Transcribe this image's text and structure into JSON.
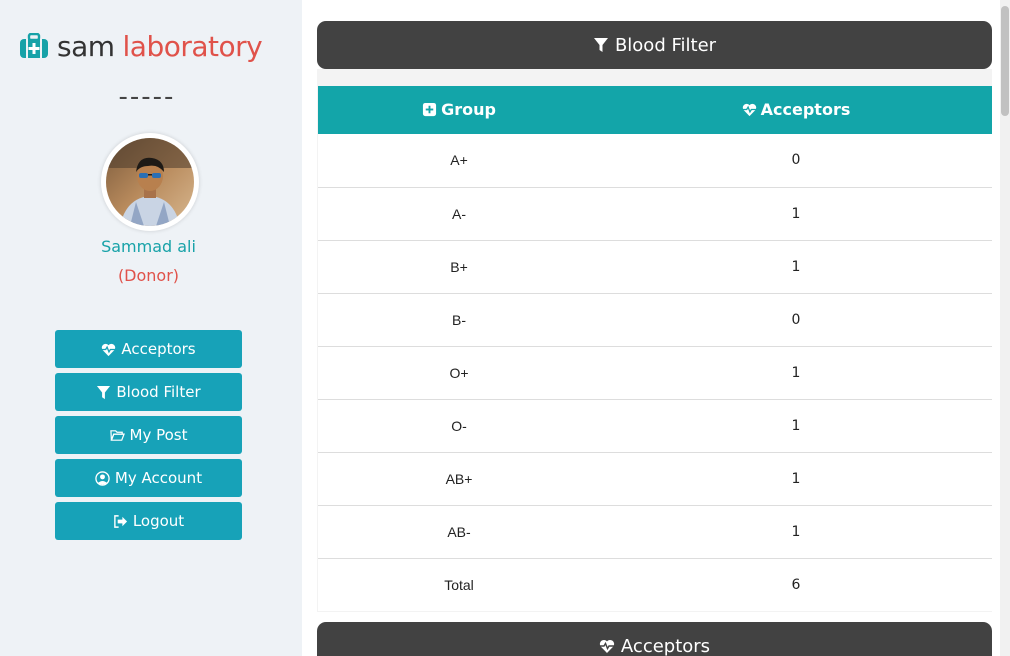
{
  "brand": {
    "name_part1": "sam",
    "name_part2": "laboratory",
    "icon": "medkit-icon"
  },
  "divider_text": "-----",
  "profile": {
    "name": "Sammad ali",
    "role": "(Donor)"
  },
  "nav": [
    {
      "label": "Acceptors",
      "icon": "heartbeat-icon"
    },
    {
      "label": "Blood Filter",
      "icon": "filter-icon"
    },
    {
      "label": "My Post",
      "icon": "folder-open-icon"
    },
    {
      "label": "My Account",
      "icon": "user-circle-icon"
    },
    {
      "label": "Logout",
      "icon": "sign-out-icon"
    }
  ],
  "panel": {
    "title": "Blood Filter"
  },
  "table": {
    "headers": {
      "group": "Group",
      "acceptors": "Acceptors"
    },
    "rows": [
      {
        "group": "A+",
        "count": "0"
      },
      {
        "group": "A-",
        "count": "1"
      },
      {
        "group": "B+",
        "count": "1"
      },
      {
        "group": "B-",
        "count": "0"
      },
      {
        "group": "O+",
        "count": "1"
      },
      {
        "group": "O-",
        "count": "1"
      },
      {
        "group": "AB+",
        "count": "1"
      },
      {
        "group": "AB-",
        "count": "1"
      }
    ],
    "total": {
      "label": "Total",
      "value": "6"
    }
  },
  "next_panel": {
    "title": "Acceptors"
  },
  "colors": {
    "teal": "#17a2b8",
    "header_teal": "#13a5a9",
    "brand_red": "#e0524a",
    "panel_dark": "#424242",
    "sidebar_bg": "#eef2f6"
  }
}
